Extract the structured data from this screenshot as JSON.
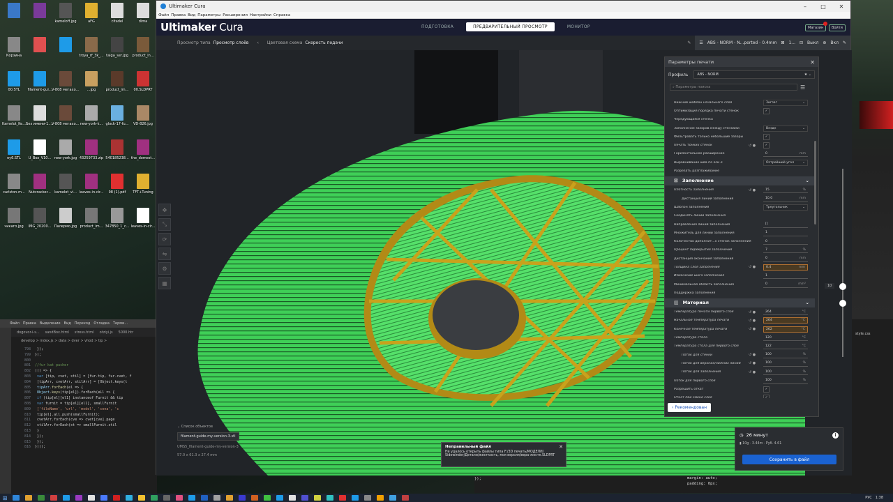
{
  "desktop": {
    "icons": [
      {
        "label": "",
        "color": "#3a78c8"
      },
      {
        "label": "",
        "color": "#7a3a9a"
      },
      {
        "label": "kameloff.jpg",
        "color": "#555555"
      },
      {
        "label": "aFG",
        "color": "#e0b030"
      },
      {
        "label": "citadel",
        "color": "#dddddd"
      },
      {
        "label": "dima",
        "color": "#dddddd"
      },
      {
        "label": "Корзина",
        "color": "#888888"
      },
      {
        "label": "",
        "color": "#e05050"
      },
      {
        "label": "",
        "color": "#1e9be8"
      },
      {
        "label": "troya_rf_3k_...",
        "color": "#8a6a4a"
      },
      {
        "label": "taiga_ser.jpg",
        "color": "#444444"
      },
      {
        "label": "product_in...",
        "color": "#7a5a3a"
      },
      {
        "label": "00.STL",
        "color": "#1e9be8"
      },
      {
        "label": "filament-gui...",
        "color": "#1e9be8"
      },
      {
        "label": "V-808 мегахолит...",
        "color": "#6a4a3a"
      },
      {
        "label": "...jpg",
        "color": "#c8a060"
      },
      {
        "label": "product_im...",
        "color": "#5a3a2a"
      },
      {
        "label": "00.SLDPRT",
        "color": "#cc3333"
      },
      {
        "label": "Kamelot_Ke...",
        "color": "#888888"
      },
      {
        "label": "Без имени-1.jpg",
        "color": "#dddddd"
      },
      {
        "label": "V-808 мегахолит...",
        "color": "#6a4a3a"
      },
      {
        "label": "new-york-k...",
        "color": "#aaaaaa"
      },
      {
        "label": "glock-17-fu...",
        "color": "#6ab0e0"
      },
      {
        "label": "VD-826.jpg",
        "color": "#aa8866"
      },
      {
        "label": "ey6.STL",
        "color": "#1e9be8"
      },
      {
        "label": "U_Box_V10...",
        "color": "#ffffff"
      },
      {
        "label": "new-york.jpg",
        "color": "#aaaaaa"
      },
      {
        "label": "43259733.zip",
        "color": "#a03080"
      },
      {
        "label": "540185238...",
        "color": "#aa3333"
      },
      {
        "label": "the_domest...",
        "color": "#a03080"
      },
      {
        "label": "carlston-m...",
        "color": "#888888"
      },
      {
        "label": "Nutcracker...",
        "color": "#a03080"
      },
      {
        "label": "kamelot_vi...",
        "color": "#555555"
      },
      {
        "label": "leaves-in-cir...",
        "color": "#a03080"
      },
      {
        "label": "98 (1).pdf",
        "color": "#e03030"
      },
      {
        "label": "TFT+Tuning",
        "color": "#e0b030"
      },
      {
        "label": "чикаго.jpg",
        "color": "#777777"
      },
      {
        "label": "IMG_20200...",
        "color": "#555555"
      },
      {
        "label": "Палермо.jpg",
        "color": "#cccccc"
      },
      {
        "label": "product_im...",
        "color": "#777777"
      },
      {
        "label": "347850_1_c...",
        "color": "#999999"
      },
      {
        "label": "leaves-in-cir...",
        "color": "#ffffff"
      }
    ]
  },
  "cura": {
    "window_title": "Ultimaker Cura",
    "menu": [
      "Файл",
      "Правка",
      "Вид",
      "Параметры",
      "Расширения",
      "Настройки",
      "Справка"
    ],
    "brand_main": "Ultimaker",
    "brand_sub": " Cura",
    "stages": [
      {
        "label": "ПОДГОТОВКА",
        "active": false
      },
      {
        "label": "ПРЕДВАРИТЕЛЬНЫЙ ПРОСМОТР",
        "active": true
      },
      {
        "label": "МОНИТОР",
        "active": false
      }
    ],
    "store_label": "Магазин",
    "signin_label": "Войти",
    "view_type_label": "Просмотр типа",
    "view_type_value": "Просмотр слоёв",
    "color_scheme_label": "Цветовая схема",
    "color_scheme_value": "Скорость подачи",
    "printer_profile": "ABS - NORM - N...ported - 0.4mm",
    "support_value": "1...",
    "adhesion_label": "Выкл",
    "adhesion2_label": "Вкл",
    "layer_number": "10",
    "panel": {
      "title": "Параметры печати",
      "profile_label": "Профиль",
      "profile_value": "ABS - NORM",
      "search_placeholder": "Параметры поиска",
      "recommended_label": "Рекомендован"
    },
    "settings_top": [
      {
        "label": "Нижний шаблон начального слоя",
        "type": "dd",
        "value": "Зигзаг"
      },
      {
        "label": "Оптимизация порядка печати стенок",
        "type": "chk",
        "value": "✓"
      },
      {
        "label": "Чередующаяся стенка",
        "type": "none",
        "value": ""
      },
      {
        "label": "Заполнение зазоров между стенками",
        "type": "dd",
        "value": "Везде"
      },
      {
        "label": "Фильтровать только небольшие зазоры",
        "type": "chk",
        "value": "✓"
      },
      {
        "label": "Печать тонких стенок",
        "type": "chk",
        "value": "✓",
        "italic": true,
        "reset": true
      },
      {
        "label": "Горизонтальное расширение",
        "type": "num",
        "value": "0",
        "unit": "mm"
      },
      {
        "label": "Выравнивание шва по оси Z",
        "type": "dd",
        "value": "Острейший угол"
      },
      {
        "label": "Разрезать разглаживание",
        "type": "none",
        "value": ""
      }
    ],
    "infill_category": "Заполнение",
    "settings_infill": [
      {
        "label": "Плотность заполнения",
        "type": "num",
        "value": "15",
        "unit": "%",
        "italic": true,
        "reset": true
      },
      {
        "label": "Дистанция линий заполнения",
        "type": "num",
        "value": "10.0",
        "unit": "mm",
        "indent": true
      },
      {
        "label": "Шаблон заполнения",
        "type": "dd",
        "value": "Треугольник"
      },
      {
        "label": "Соединять линии заполнения",
        "type": "none",
        "value": ""
      },
      {
        "label": "Направления линий заполнения",
        "type": "num",
        "value": "[]",
        "unit": ""
      },
      {
        "label": "Множитель для линии заполнения",
        "type": "num",
        "value": "1",
        "unit": ""
      },
      {
        "label": "Количество дополнит...х стенок заполнения",
        "type": "num",
        "value": "0",
        "unit": ""
      },
      {
        "label": "Процент перекрытия заполнения",
        "type": "num",
        "value": "7",
        "unit": "%",
        "italic": true
      },
      {
        "label": "Дистанция окончания заполнения",
        "type": "num",
        "value": "0",
        "unit": "mm"
      },
      {
        "label": "Толщина слоя заполнения",
        "type": "num",
        "value": "0.4",
        "unit": "mm",
        "italic": true,
        "reset": true,
        "hl": true
      },
      {
        "label": "Изменение шага заполнения",
        "type": "num",
        "value": "1",
        "unit": "",
        "italic": true
      },
      {
        "label": "Минимальная область заполнения",
        "type": "num",
        "value": "0",
        "unit": "mm²"
      },
      {
        "label": "Поддержка заполнения",
        "type": "none",
        "value": ""
      }
    ],
    "material_category": "Материал",
    "settings_material": [
      {
        "label": "Температура печати первого слоя",
        "type": "num",
        "value": "264",
        "unit": "°C",
        "italic": true,
        "reset": true
      },
      {
        "label": "Начальная температура печати",
        "type": "num",
        "value": "264",
        "unit": "°C",
        "italic": true,
        "reset": true,
        "hl": true
      },
      {
        "label": "Конечная температура печати",
        "type": "num",
        "value": "262",
        "unit": "°C",
        "italic": true,
        "reset": true,
        "hl": true
      },
      {
        "label": "Температура стола",
        "type": "num",
        "value": "120",
        "unit": "°C",
        "italic": true
      },
      {
        "label": "Температура стола для первого слоя",
        "type": "num",
        "value": "122",
        "unit": "°C",
        "italic": true
      },
      {
        "label": "Поток для стенки",
        "type": "num",
        "value": "100",
        "unit": "%",
        "italic": true,
        "indent": true,
        "reset": true
      },
      {
        "label": "Поток для верхних/нижних линий",
        "type": "num",
        "value": "100",
        "unit": "%",
        "italic": true,
        "indent": true,
        "reset": true
      },
      {
        "label": "Поток для заполнения",
        "type": "num",
        "value": "100",
        "unit": "%",
        "italic": true,
        "indent": true,
        "reset": true
      },
      {
        "label": "Поток для первого слоя",
        "type": "num",
        "value": "100",
        "unit": "%",
        "italic": true
      },
      {
        "label": "Разрешить откат",
        "type": "chk",
        "value": "✓"
      },
      {
        "label": "Откат при смене слоя",
        "type": "chk",
        "value": "✓",
        "italic": true
      }
    ],
    "object_list_label": "Список объектов",
    "object_file": "filament-guide-my-version-3.stl",
    "object_meta": "UMS5_filament-guide-my-version-3",
    "object_dims": "57.0 x 61.3 x 27.4 mm",
    "error": {
      "title": "Неправильный файл",
      "body": "Не удалось открыть файлы типа F:/3D печать/МОДЕЛИ/ Sidewinder/Детали/жесткость, моя версия/вера-жестк.SLDPRT"
    },
    "save": {
      "time": "26 минут",
      "material": "10g · 3.44m · Руб. 4.61",
      "button": "Сохранить в файл"
    }
  },
  "vscode": {
    "menu": [
      "Файл",
      "Правка",
      "Выделение",
      "Вид",
      "Переход",
      "Отладка",
      "Терми..."
    ],
    "tabs": [
      "dogovor-i-s...",
      "sandBox.html",
      "stress.html",
      "otziyi.js",
      "5000.htr"
    ],
    "crumb": "develop > index.js > data > dver > vhod > tip >",
    "right_tab": "style.css",
    "lines": [
      {
        "n": "798",
        "html": "<span class='c-p'>  });</span>"
      },
      {
        "n": "799",
        "html": "<span class='c-p'>});</span>"
      },
      {
        "n": "800",
        "html": ""
      },
      {
        "n": "801",
        "html": "<span class='c-c'>//fur kat pusher</span>"
      },
      {
        "n": "802",
        "html": "<span class='c-p'>(() =&gt; {</span>"
      },
      {
        "n": "803",
        "html": "<span class='c-k'>  var</span> <span class='c-p'>[tip, cvet, stil] = [fur.tip, fur.cvet, f</span>"
      },
      {
        "n": "804",
        "html": "<span class='c-p'>    [tipArr, cvetArr, stilArr] = [Object.keys(t</span>"
      },
      {
        "n": "805",
        "html": "<span class='c-v'>  tipArr</span><span class='c-p'>.</span><span class='c-f'>forEach</span><span class='c-p'>(el =&gt; {</span>"
      },
      {
        "n": "806",
        "html": "<span class='c-v'>    Object</span><span class='c-p'>.</span><span class='c-f'>keys</span><span class='c-p'>(tip[el]).forEach(eLl =&gt; {</span>"
      },
      {
        "n": "807",
        "html": "<span class='c-k'>      if</span> <span class='c-p'>(tip[el][el1] instanceof Furnit &amp;&amp; tip</span>"
      },
      {
        "n": "808",
        "html": "<span class='c-k'>        var</span> <span class='c-p'>furnit = tip[el][el1], smallFurnit</span>"
      },
      {
        "n": "809",
        "html": "<span class='c-s'>          ['fileName', 'url', 'model', 'cena', 'c</span>"
      },
      {
        "n": "810",
        "html": "<span class='c-p'>          tip[el].all.push(smallFurnit);</span>"
      },
      {
        "n": "811",
        "html": "<span class='c-p'>          cvetArr.forEach(cve =&gt; cvet[cve].page</span>"
      },
      {
        "n": "812",
        "html": "<span class='c-p'>          stilArr.forEach(st =&gt; smallFurnit.stil</span>"
      },
      {
        "n": "813",
        "html": "<span class='c-p'>        }</span>"
      },
      {
        "n": "814",
        "html": "<span class='c-p'>      });</span>"
      },
      {
        "n": "815",
        "html": "<span class='c-p'>  });</span>"
      },
      {
        "n": "816",
        "html": "<span class='c-p'>})();</span>"
      }
    ],
    "bottom_left": "});",
    "bottom_r1": "margin: auto;",
    "bottom_r2": "padding: 0px;"
  },
  "taskbar": {
    "lang": "РУС",
    "time": "1:38"
  }
}
